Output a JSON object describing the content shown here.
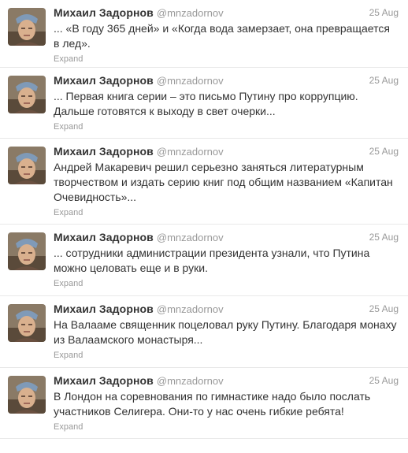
{
  "author": {
    "name": "Михаил Задорнов",
    "handle": "@mnzadornov"
  },
  "expand_label": "Expand",
  "tweets": [
    {
      "date": "25 Aug",
      "text": "... «В году 365 дней» и «Когда вода замерзает, она превращается в лед»."
    },
    {
      "date": "25 Aug",
      "text": "... Первая книга серии – это письмо Путину про коррупцию. Дальше готовятся к выходу в свет очерки..."
    },
    {
      "date": "25 Aug",
      "text": "Андрей Макаревич решил серьезно заняться литературным творчеством и издать серию книг под общим названием «Капитан Очевидность»..."
    },
    {
      "date": "25 Aug",
      "text": "... сотрудники администрации президента узнали, что Путина можно целовать еще и в руки."
    },
    {
      "date": "25 Aug",
      "text": "На Валааме священник поцеловал руку Путину. Благодаря монаху из Валаамского монастыря..."
    },
    {
      "date": "25 Aug",
      "text": "В Лондон на соревнования по гимнастике надо было послать участников Селигера. Они-то у нас очень гибкие ребята!"
    }
  ]
}
